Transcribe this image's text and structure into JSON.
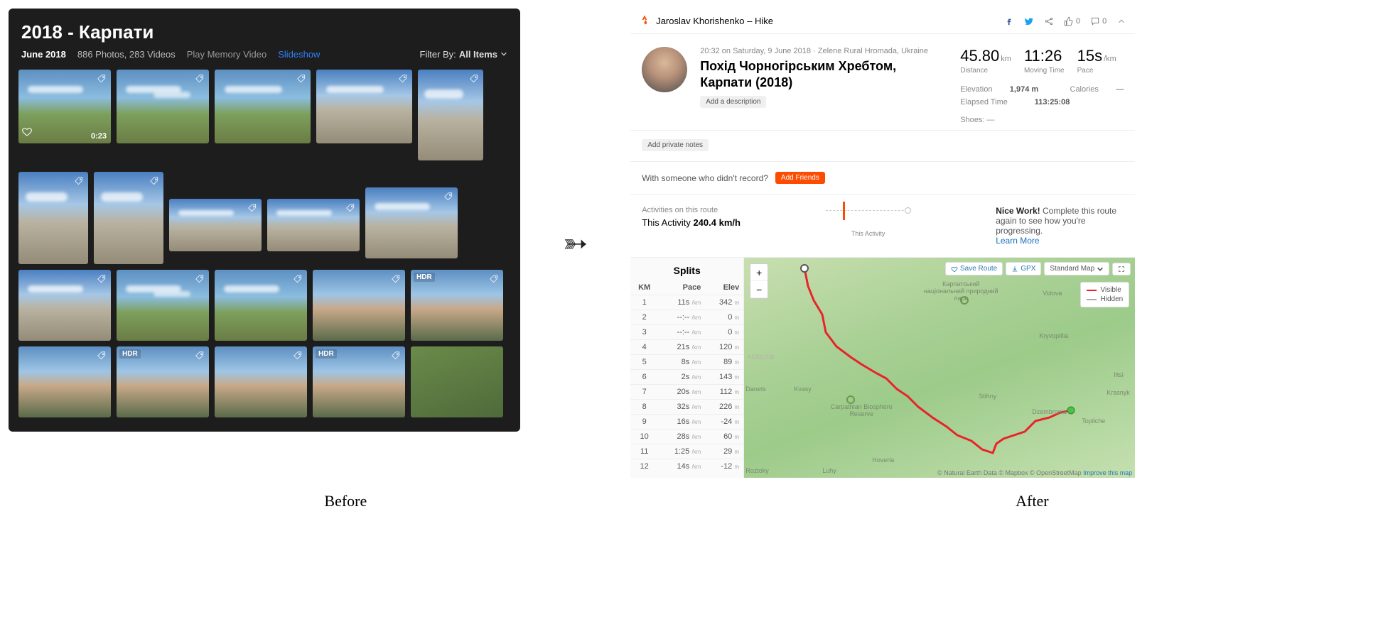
{
  "captions": {
    "before": "Before",
    "after": "After"
  },
  "photos_app": {
    "album_title": "2018 - Карпати",
    "date": "June 2018",
    "counts": "886 Photos, 283 Videos",
    "memory_link": "Play Memory Video",
    "slideshow_link": "Slideshow",
    "filter_label": "Filter By:",
    "filter_value": "All Items",
    "hdr_badge": "HDR",
    "video_duration": "0:23"
  },
  "strava": {
    "header_user": "Jaroslav Khorishenko – Hike",
    "kudos_count": "0",
    "comments_count": "0",
    "timestamp": "20:32 on Saturday, 9 June 2018 · Zelene Rural Hromada, Ukraine",
    "activity_title": "Похід Чорногірським Хребтом, Карпати (2018)",
    "add_description": "Add a description",
    "add_notes": "Add private notes",
    "friends_text": "With someone who didn't record?",
    "add_friends": "Add Friends",
    "stats": {
      "distance_v": "45.80",
      "distance_u": "km",
      "distance_l": "Distance",
      "time_v": "11:26",
      "time_l": "Moving Time",
      "pace_v": "15s",
      "pace_u": "/km",
      "pace_l": "Pace",
      "elevation_l": "Elevation",
      "elevation_v": "1,974 m",
      "elapsed_l": "Elapsed Time",
      "elapsed_v": "113:25:08",
      "calories_l": "Calories",
      "calories_v": "—",
      "shoes": "Shoes: —"
    },
    "route": {
      "header": "Activities on this route",
      "line_prefix": "This Activity ",
      "value": "240.4 km/h",
      "mid_label": "This Activity",
      "nice_bold": "Nice Work!",
      "nice_text": " Complete this route again to see how you're progressing.",
      "learn_more": "Learn More"
    },
    "splits": {
      "title": "Splits",
      "headers": {
        "km": "KM",
        "pace": "Pace",
        "elev": "Elev"
      },
      "rows": [
        {
          "km": "1",
          "pace": "11s",
          "elev": "342"
        },
        {
          "km": "2",
          "pace": "--:--",
          "elev": "0"
        },
        {
          "km": "3",
          "pace": "--:--",
          "elev": "0"
        },
        {
          "km": "4",
          "pace": "21s",
          "elev": "120"
        },
        {
          "km": "5",
          "pace": "8s",
          "elev": "89"
        },
        {
          "km": "6",
          "pace": "2s",
          "elev": "143"
        },
        {
          "km": "7",
          "pace": "20s",
          "elev": "112"
        },
        {
          "km": "8",
          "pace": "32s",
          "elev": "226"
        },
        {
          "km": "9",
          "pace": "16s",
          "elev": "-24"
        },
        {
          "km": "10",
          "pace": "28s",
          "elev": "60"
        },
        {
          "km": "11",
          "pace": "1:25",
          "elev": "29"
        },
        {
          "km": "12",
          "pace": "14s",
          "elev": "-12"
        }
      ],
      "pace_unit": "/km",
      "elev_unit": "m"
    },
    "map": {
      "save_route": "Save Route",
      "gpx": "GPX",
      "map_style": "Standard Map",
      "legend_visible": "Visible",
      "legend_hidden": "Hidden",
      "attrib_prefix": "© Natural Earth Data © Mapbox © OpenStreetMap ",
      "attrib_link": "Improve this map",
      "places": {
        "park": "Карпатський національний природний парк",
        "reserve": "Carpathian Biosphere Reserve",
        "volova": "Volova",
        "kryvopillia": "Kryvopillia",
        "iltsi": "Iltsi",
        "krasnyk": "Krasnyk",
        "dzembronia": "Dzembronia",
        "topilche": "Topilche",
        "hoverla": "Hoverla",
        "kvasy": "Kvasy",
        "roztoky": "Roztoky",
        "luhy": "Luhy",
        "stihny": "Stihny",
        "kevelin": "КЕВЕЛІВ",
        "danets": "Danets"
      }
    }
  }
}
